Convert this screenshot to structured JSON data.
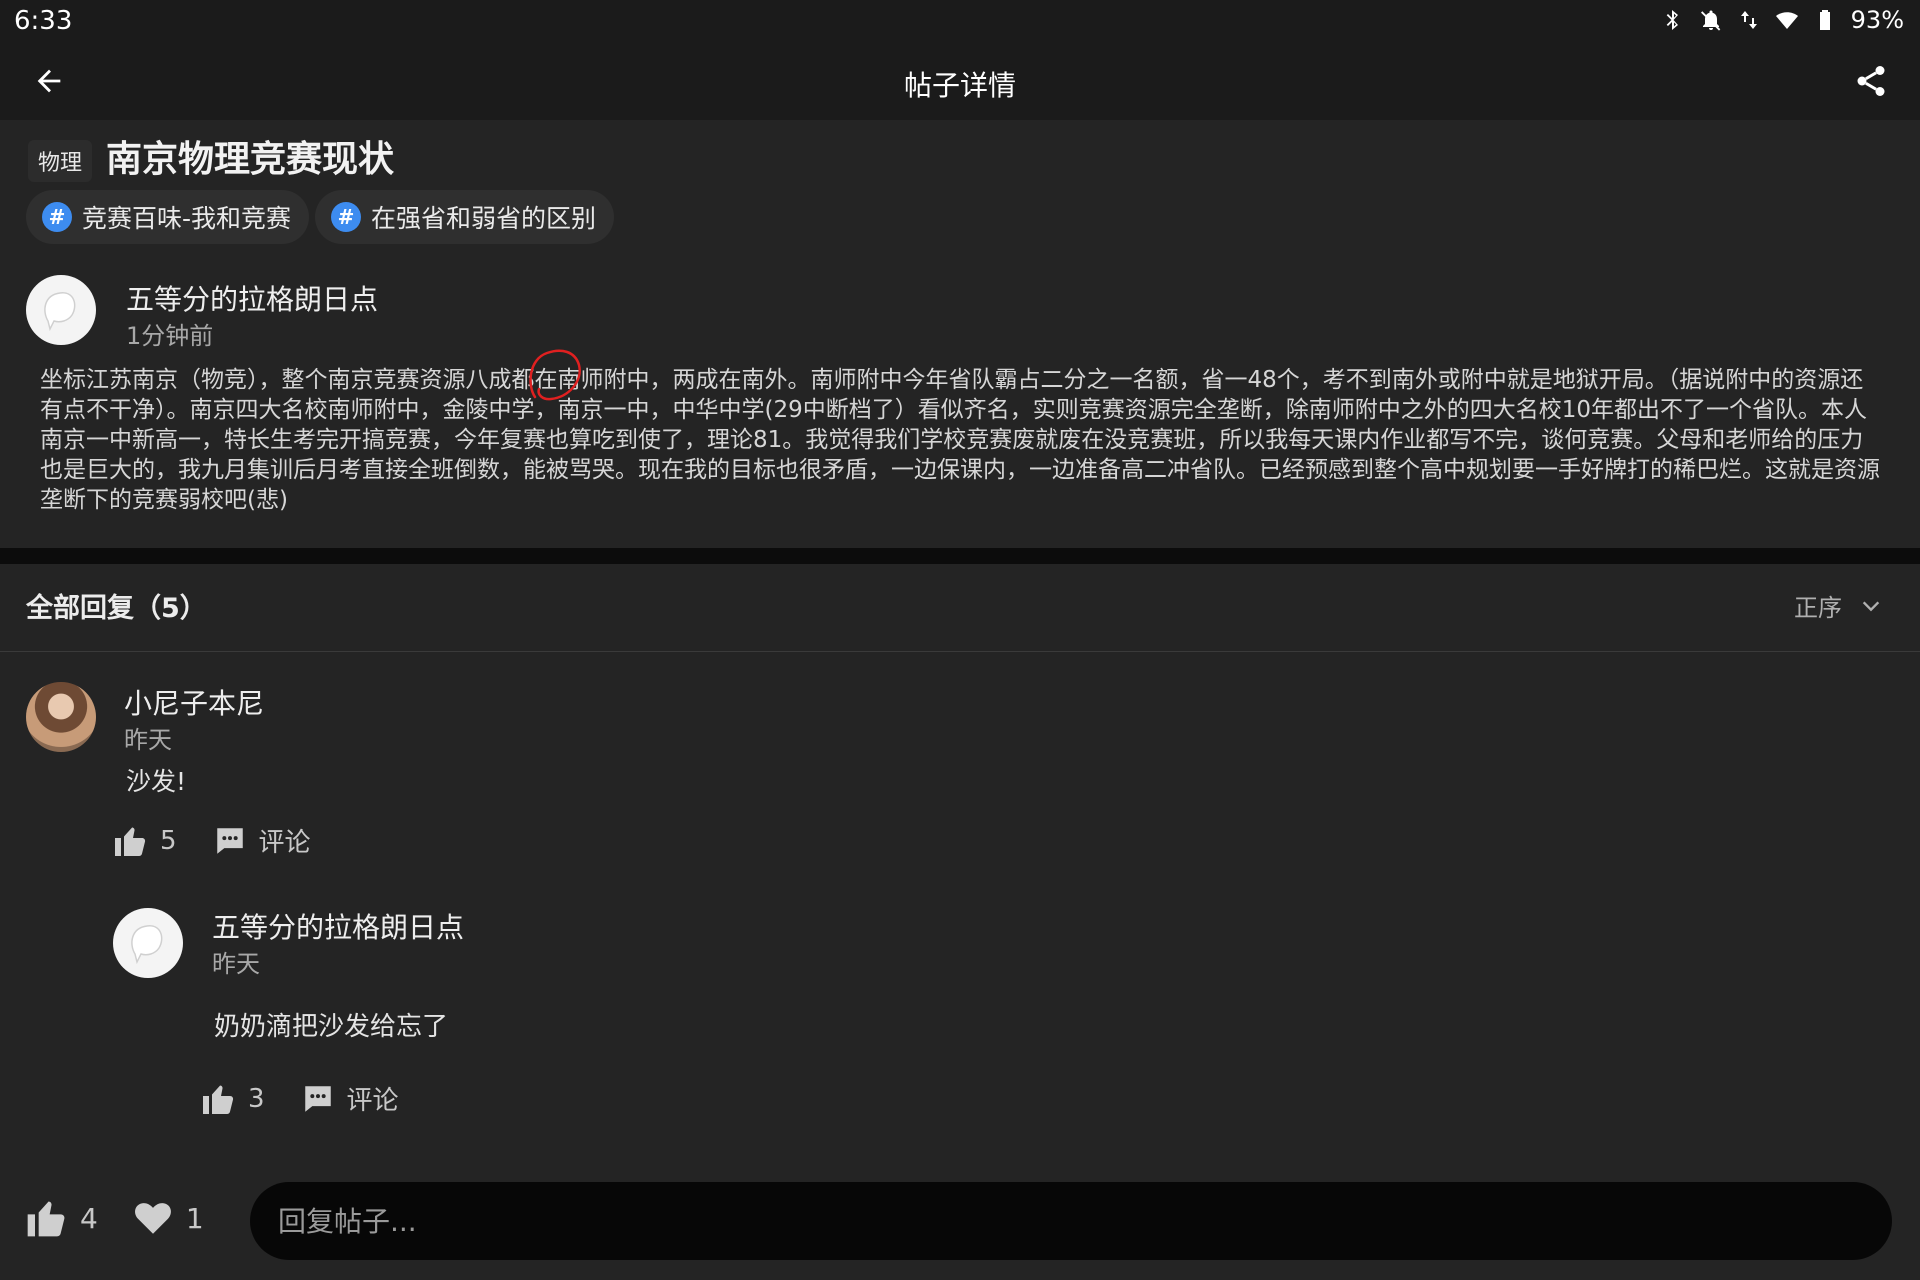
{
  "status_bar": {
    "time": "6:33",
    "battery": "93%",
    "icons": [
      "bluetooth-icon",
      "bell-off-icon",
      "data-arrows-icon",
      "wifi-icon",
      "battery-icon"
    ]
  },
  "app_bar": {
    "title": "帖子详情",
    "back_icon": "arrow-left-icon",
    "share_icon": "share-icon"
  },
  "post": {
    "category": "物理",
    "title": "南京物理竞赛现状",
    "topics": [
      {
        "label": "竞赛百味-我和竞赛"
      },
      {
        "label": "在强省和弱省的区别"
      }
    ],
    "author": {
      "name": "五等分的拉格朗日点",
      "time": "1分钟前"
    },
    "body": "坐标江苏南京（物竞），整个南京竞赛资源八成都在南师附中，两成在南外。南师附中今年省队霸占二分之一名额，省一48个，考不到南外或附中就是地狱开局。（据说附中的资源还有点不干净）。南京四大名校南师附中，金陵中学，南京一中，中华中学(29中断档了）看似齐名，实则竞赛资源完全垄断，除南师附中之外的四大名校10年都出不了一个省队。本人南京一中新高一，特长生考完开搞竞赛，今年复赛也算吃到使了，理论81。我觉得我们学校竞赛废就废在没竞赛班，所以我每天课内作业都写不完，谈何竞赛。父母和老师给的压力也是巨大的，我九月集训后月考直接全班倒数，能被骂哭。现在我的目标也很矛盾，一边保课内，一边准备高二冲省队。已经预感到整个高中规划要一手好牌打的稀巴烂。这就是资源垄断下的竞赛弱校吧(悲)"
  },
  "replies": {
    "header": "全部回复（5）",
    "sort_label": "正序",
    "items": [
      {
        "author": "小尼子本尼",
        "time": "昨天",
        "text": "沙发!",
        "likes": "5",
        "comment_label": "评论",
        "sub_reply": {
          "author": "五等分的拉格朗日点",
          "time": "昨天",
          "text": "奶奶滴把沙发给忘了",
          "likes": "3",
          "comment_label": "评论"
        }
      }
    ]
  },
  "bottom_bar": {
    "likes": "4",
    "favorites": "1",
    "reply_placeholder": "回复帖子..."
  },
  "colors": {
    "background": "#232323",
    "bar": "#1b1b1b",
    "accent": "#3d8cf0",
    "annotation": "#e02020"
  }
}
